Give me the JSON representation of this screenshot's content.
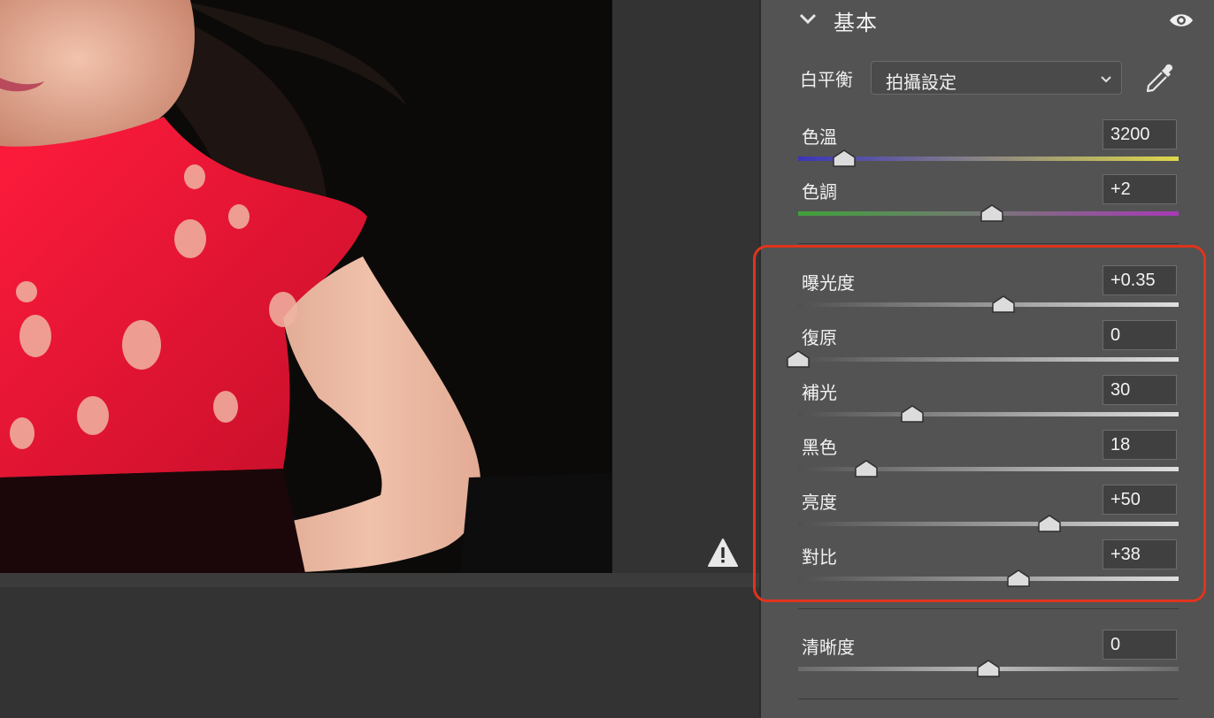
{
  "panel": {
    "section_title": "基本",
    "white_balance": {
      "label": "白平衡",
      "value": "拍攝設定"
    },
    "sliders": [
      {
        "id": "temperature",
        "label": "色溫",
        "value": "3200",
        "position": 0.12
      },
      {
        "id": "tint",
        "label": "色調",
        "value": "+2",
        "position": 0.51
      },
      {
        "id": "exposure",
        "label": "曝光度",
        "value": "+0.35",
        "position": 0.54
      },
      {
        "id": "recovery",
        "label": "復原",
        "value": "0",
        "position": 0.0
      },
      {
        "id": "fill-light",
        "label": "補光",
        "value": "30",
        "position": 0.3
      },
      {
        "id": "blacks",
        "label": "黑色",
        "value": "18",
        "position": 0.18
      },
      {
        "id": "brightness",
        "label": "亮度",
        "value": "+50",
        "position": 0.66
      },
      {
        "id": "contrast",
        "label": "對比",
        "value": "+38",
        "position": 0.58
      },
      {
        "id": "clarity",
        "label": "清晰度",
        "value": "0",
        "position": 0.5
      }
    ]
  },
  "colors": {
    "highlight": "#e0341c",
    "panel_bg": "#535353",
    "temperature_gradient": [
      "#3a35b8",
      "#ddd84a"
    ],
    "tint_gradient": [
      "#3fa03a",
      "#a73ab5"
    ]
  },
  "icons": {
    "section_toggle": "chevron-down-icon",
    "visibility": "eye-icon",
    "picker": "eyedropper-icon",
    "warning": "warning-icon"
  }
}
